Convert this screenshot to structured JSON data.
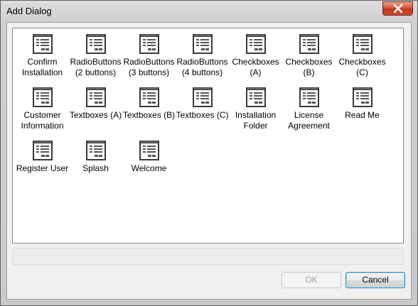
{
  "window": {
    "title": "Add Dialog"
  },
  "icon_name": "dialog-template-icon",
  "items": [
    {
      "label": "Confirm Installation"
    },
    {
      "label": "RadioButtons (2 buttons)"
    },
    {
      "label": "RadioButtons (3 buttons)"
    },
    {
      "label": "RadioButtons (4 buttons)"
    },
    {
      "label": "Checkboxes (A)"
    },
    {
      "label": "Checkboxes (B)"
    },
    {
      "label": "Checkboxes (C)"
    },
    {
      "label": "Customer Information"
    },
    {
      "label": "Textboxes (A)"
    },
    {
      "label": "Textboxes (B)"
    },
    {
      "label": "Textboxes (C)"
    },
    {
      "label": "Installation Folder"
    },
    {
      "label": "License Agreement"
    },
    {
      "label": "Read Me"
    },
    {
      "label": "Register User"
    },
    {
      "label": "Splash"
    },
    {
      "label": "Welcome"
    }
  ],
  "buttons": {
    "ok": "OK",
    "cancel": "Cancel"
  }
}
